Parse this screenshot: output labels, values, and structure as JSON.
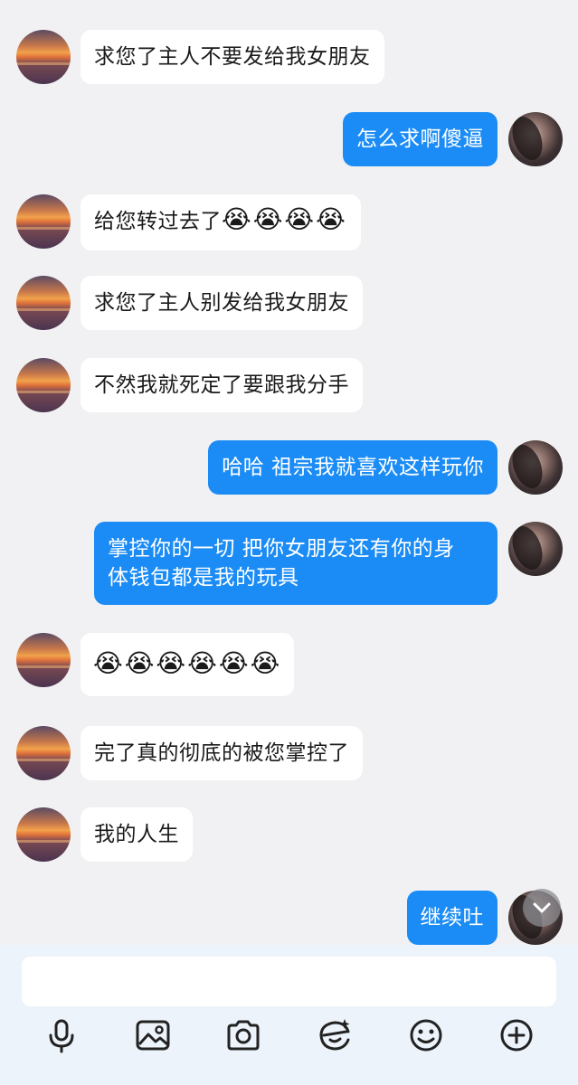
{
  "messages": [
    {
      "side": "in",
      "text": "求您了主人不要发给我女朋友"
    },
    {
      "side": "out",
      "text": "怎么求啊傻逼"
    },
    {
      "side": "in",
      "text": "给您转过去了",
      "emoji": "😭😭😭😭"
    },
    {
      "side": "in",
      "text": "求您了主人别发给我女朋友"
    },
    {
      "side": "in",
      "text": "不然我就死定了要跟我分手"
    },
    {
      "side": "out",
      "text": "哈哈 祖宗我就喜欢这样玩你"
    },
    {
      "side": "out",
      "line1": "掌控你的一切 把你女朋友还有你的身",
      "line2": "体钱包都是我的玩具"
    },
    {
      "side": "in",
      "emoji": "😭😭😭😭😭😭"
    },
    {
      "side": "in",
      "text": "完了真的彻底的被您掌控了"
    },
    {
      "side": "in",
      "text": "我的人生"
    },
    {
      "side": "out",
      "text": "继续吐"
    }
  ],
  "input": {
    "placeholder": ""
  },
  "toolbar": {
    "icons": [
      "microphone-icon",
      "image-icon",
      "camera-icon",
      "sticker-icon",
      "emoji-icon",
      "plus-icon"
    ]
  },
  "colors": {
    "out_bubble": "#1b8cf5",
    "in_bubble": "#ffffff",
    "background": "#f1f1f3"
  }
}
